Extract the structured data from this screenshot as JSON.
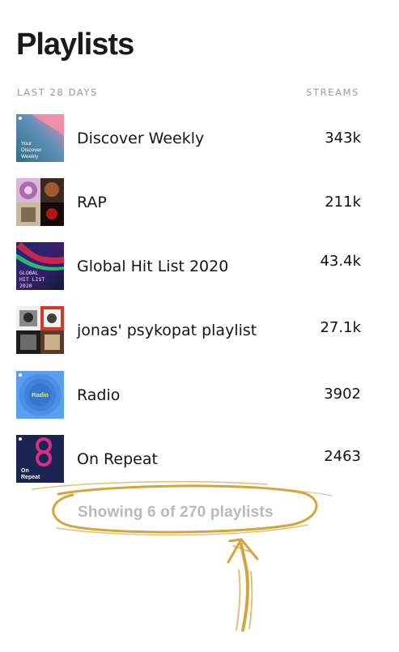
{
  "header": {
    "title": "Playlists",
    "period_label": "LAST 28 DAYS",
    "streams_label": "STREAMS"
  },
  "playlists": [
    {
      "name": "Discover Weekly",
      "streams": "343k",
      "cover_text": [
        "Your",
        "Discover",
        "Weekly"
      ]
    },
    {
      "name": "RAP",
      "streams": "211k"
    },
    {
      "name": "Global Hit List 2020",
      "streams": "43.4k",
      "cover_text": [
        "GLOBAL",
        "HIT LIST",
        "2020"
      ]
    },
    {
      "name": "jonas' psykopat playlist",
      "streams": "27.1k"
    },
    {
      "name": "Radio",
      "streams": "3902",
      "cover_text": [
        "Radio"
      ]
    },
    {
      "name": "On Repeat",
      "streams": "2463",
      "cover_text": [
        "On",
        "Repeat"
      ]
    }
  ],
  "footer": {
    "showing_text": "Showing 6 of 270 playlists"
  },
  "colors": {
    "annotation_gold": "#d4a53a",
    "muted_text": "#9a9a9a",
    "footer_text": "#b9b9b9"
  }
}
